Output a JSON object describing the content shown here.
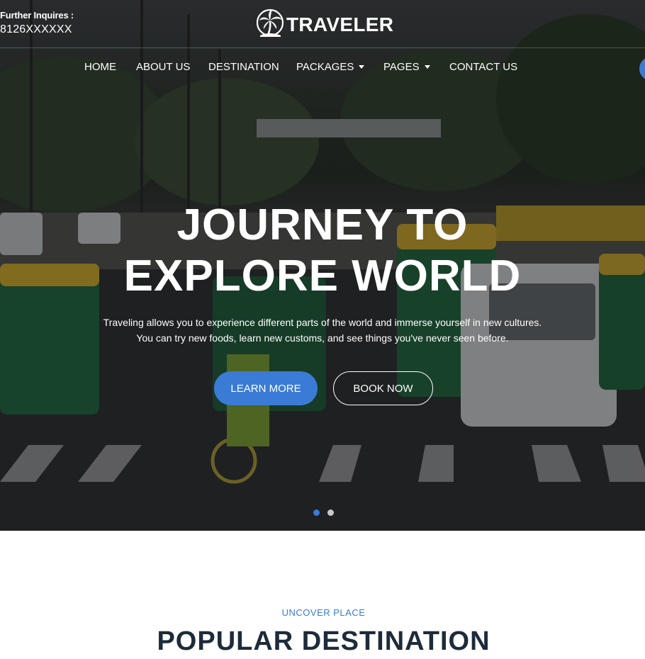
{
  "header": {
    "contact_label": "Further Inquires :",
    "contact_phone": "8126XXXXXX",
    "logo_text": "TRAVELER",
    "logo_icon": "palm-tree-icon"
  },
  "nav": {
    "items": [
      {
        "label": "HOME",
        "has_dropdown": false
      },
      {
        "label": "ABOUT US",
        "has_dropdown": false
      },
      {
        "label": "DESTINATION",
        "has_dropdown": false
      },
      {
        "label": "PACKAGES",
        "has_dropdown": true
      },
      {
        "label": "PAGES",
        "has_dropdown": true
      },
      {
        "label": "CONTACT US",
        "has_dropdown": false
      }
    ]
  },
  "hero": {
    "title_line1": "JOURNEY TO",
    "title_line2": "EXPLORE WORLD",
    "subtitle_line1": "Traveling allows you to experience different parts of the world and immerse yourself in new cultures.",
    "subtitle_line2": "You can try new foods, learn new customs, and see things you've never seen before.",
    "learn_more_label": "LEARN MORE",
    "book_now_label": "BOOK NOW",
    "active_slide": 1,
    "slide_count": 2
  },
  "section": {
    "eyebrow": "UNCOVER PLACE",
    "title": "POPULAR DESTINATION"
  },
  "colors": {
    "accent": "#3a7bd5",
    "title_dark": "#1d2b3a",
    "dot_inactive": "#c9c9c9"
  }
}
